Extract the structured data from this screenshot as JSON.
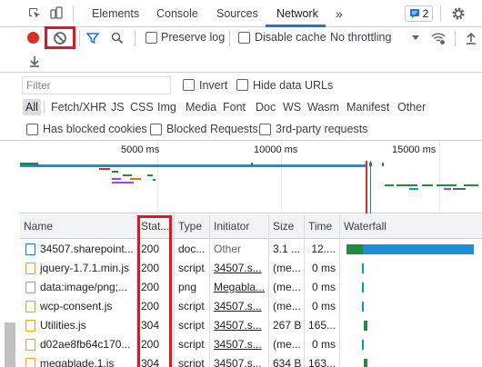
{
  "tabs": {
    "elements": "Elements",
    "console": "Console",
    "sources": "Sources",
    "network": "Network",
    "more": "»"
  },
  "badge_count": "2",
  "toolbar": {
    "preserve_log": "Preserve log",
    "disable_cache": "Disable cache",
    "throttling": "No throttling"
  },
  "filter": {
    "placeholder": "Filter",
    "invert": "Invert",
    "hide_data_urls": "Hide data URLs",
    "types": [
      "All",
      "Fetch/XHR",
      "JS",
      "CSS",
      "Img",
      "Media",
      "Font",
      "Doc",
      "WS",
      "Wasm",
      "Manifest",
      "Other"
    ],
    "has_blocked_cookies": "Has blocked cookies",
    "blocked_requests": "Blocked Requests",
    "third_party": "3rd-party requests"
  },
  "overview": {
    "ticks": [
      "5000 ms",
      "10000 ms",
      "15000 ms"
    ]
  },
  "table": {
    "headers": {
      "name": "Name",
      "status": "Stat...",
      "type": "Type",
      "initiator": "Initiator",
      "size": "Size",
      "time": "Time",
      "waterfall": "Waterfall"
    },
    "rows": [
      {
        "name": "34507.sharepoint...",
        "status": "200",
        "type": "doc...",
        "initiator": "Other",
        "size": "3.1 ...",
        "time": "12....",
        "icon": "document-icon"
      },
      {
        "name": "jquery-1.7.1.min.js",
        "status": "200",
        "type": "script",
        "initiator": "34507.s...",
        "size": "(me...",
        "time": "0 ms",
        "icon": "script-icon"
      },
      {
        "name": "data:image/png;...",
        "status": "200",
        "type": "png",
        "initiator": "Megabla...",
        "size": "(me...",
        "time": "0 ms",
        "icon": "image-icon"
      },
      {
        "name": "wcp-consent.js",
        "status": "200",
        "type": "script",
        "initiator": "34507.s...",
        "size": "(me...",
        "time": "0 ms",
        "icon": "script-icon"
      },
      {
        "name": "Utilities.js",
        "status": "304",
        "type": "script",
        "initiator": "34507.s...",
        "size": "267 B",
        "time": "165...",
        "icon": "script-icon"
      },
      {
        "name": "d02ae8fb64c170...",
        "status": "200",
        "type": "script",
        "initiator": "34507.s...",
        "size": "(me...",
        "time": "0 ms",
        "icon": "script-icon"
      },
      {
        "name": "megablade.1.js",
        "status": "304",
        "type": "script",
        "initiator": "34507.s...",
        "size": "634 B",
        "time": "163...",
        "icon": "script-icon"
      }
    ]
  },
  "colors": {
    "accent": "#1a73e8",
    "record": "#d93025",
    "highlight": "#e8141c",
    "waterfall_blue": "#1a8fd6",
    "waterfall_green": "#1e8e3e",
    "waterfall_teal": "#00a0b0"
  }
}
